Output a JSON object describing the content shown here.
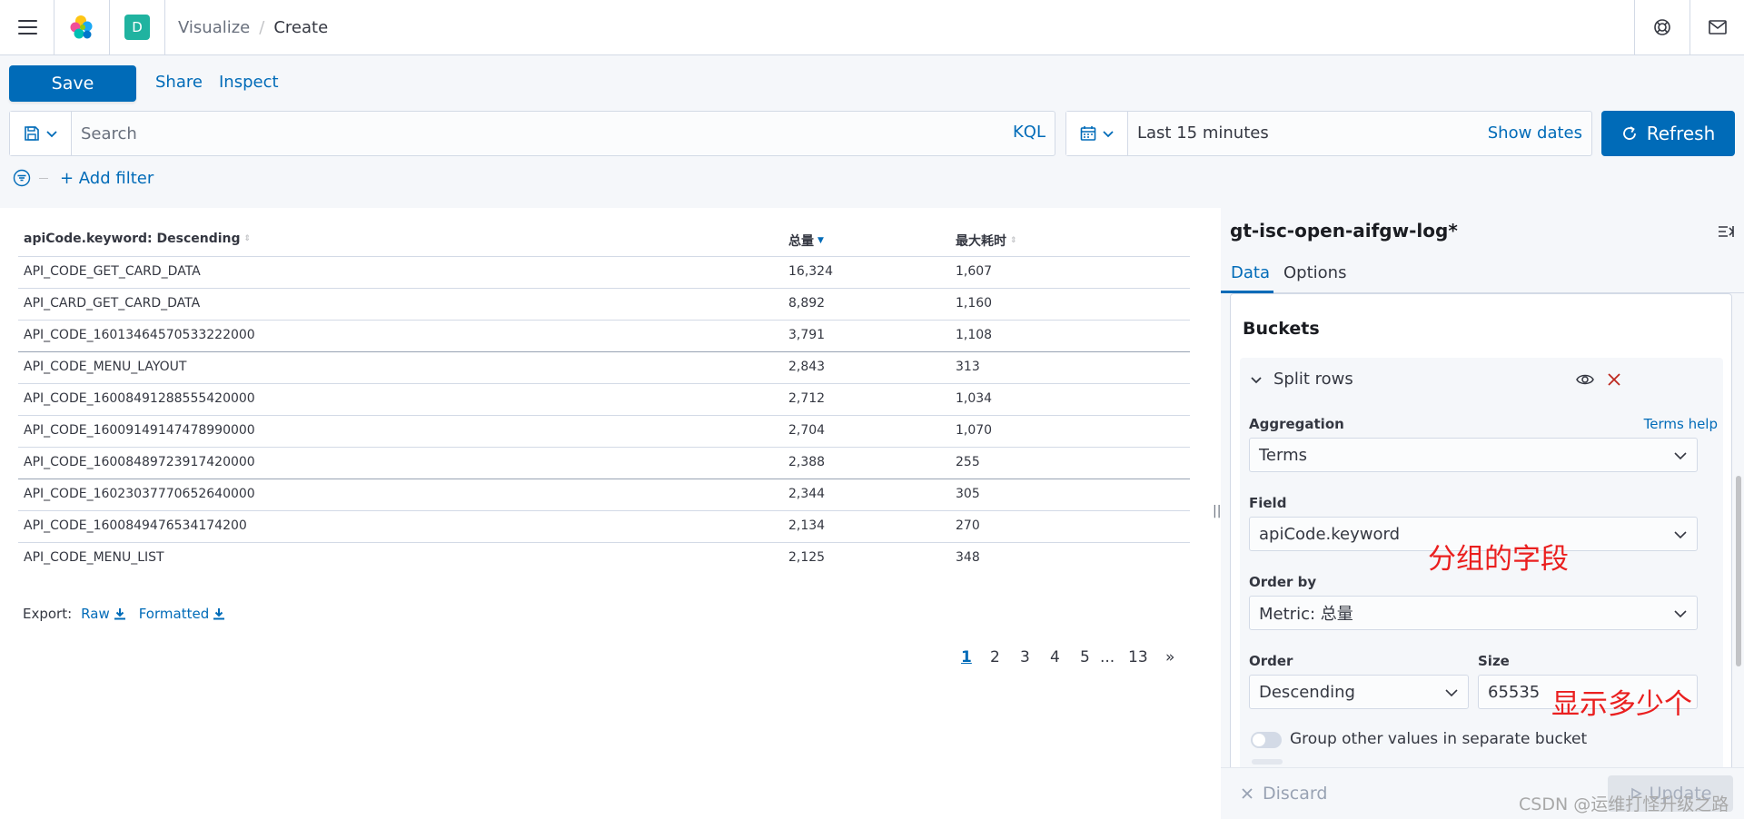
{
  "header": {
    "space_initial": "D",
    "breadcrumbs": [
      "Visualize",
      "Create"
    ],
    "colors": {
      "accent": "#006bb8",
      "space_avatar": "#20b3a0"
    }
  },
  "topnav": {
    "save_label": "Save",
    "share_label": "Share",
    "inspect_label": "Inspect",
    "search_placeholder": "Search",
    "search_value": "",
    "query_language": "KQL",
    "time_range": "Last 15 minutes",
    "show_dates_label": "Show dates",
    "refresh_label": "Refresh",
    "add_filter_label": "+ Add filter"
  },
  "table": {
    "columns": [
      "apiCode.keyword: Descending",
      "总量",
      "最大耗时"
    ],
    "sorted_column": "总量",
    "rows": [
      [
        "API_CODE_GET_CARD_DATA",
        "16,324",
        "1,607"
      ],
      [
        "API_CARD_GET_CARD_DATA",
        "8,892",
        "1,160"
      ],
      [
        "API_CODE_16013464570533222000",
        "3,791",
        "1,108"
      ],
      [
        "API_CODE_MENU_LAYOUT",
        "2,843",
        "313"
      ],
      [
        "API_CODE_16008491288555420000",
        "2,712",
        "1,034"
      ],
      [
        "API_CODE_16009149147478990000",
        "2,704",
        "1,070"
      ],
      [
        "API_CODE_16008489723917420000",
        "2,388",
        "255"
      ],
      [
        "API_CODE_16023037770652640000",
        "2,344",
        "305"
      ],
      [
        "API_CODE_1600849476534174200",
        "2,134",
        "270"
      ],
      [
        "API_CODE_MENU_LIST",
        "2,125",
        "348"
      ]
    ],
    "export_label": "Export:",
    "export_raw": "Raw",
    "export_formatted": "Formatted",
    "pagination": {
      "pages": [
        "1",
        "2",
        "3",
        "4",
        "5"
      ],
      "ellipsis": "...",
      "last_page": "13",
      "next": "»",
      "current_page": "1"
    }
  },
  "sidebar": {
    "index_pattern": "gt-isc-open-aifgw-log*",
    "tabs": [
      "Data",
      "Options"
    ],
    "selected_tab": "Data",
    "buckets_title": "Buckets",
    "split_title": "Split rows",
    "aggregation_label": "Aggregation",
    "aggregation_help": "Terms help",
    "aggregation_value": "Terms",
    "field_label": "Field",
    "field_value": "apiCode.keyword",
    "order_by_label": "Order by",
    "order_by_value": "Metric: 总量",
    "order_label": "Order",
    "order_value": "Descending",
    "size_label": "Size",
    "size_value": "65535",
    "group_other_label": "Group other values in separate bucket",
    "group_other_enabled": false,
    "discard_label": "Discard",
    "update_label": "Update"
  },
  "annotations": {
    "field_note": "分组的字段",
    "size_note": "显示多少个",
    "color": "#ea1f1f"
  },
  "watermark": "CSDN @运维打怪升级之路"
}
